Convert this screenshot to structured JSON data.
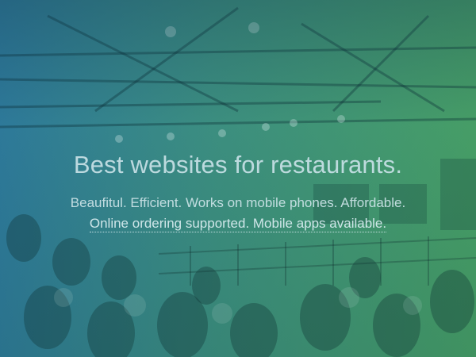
{
  "hero": {
    "headline": "Best websites for restaurants.",
    "tagline": "Beaufitul. Efficient. Works on mobile phones. Affordable.",
    "link_text": "Online ordering supported. Mobile apps available."
  },
  "colors": {
    "gradient_left": "#2f7c9e",
    "gradient_right": "#49a268"
  }
}
